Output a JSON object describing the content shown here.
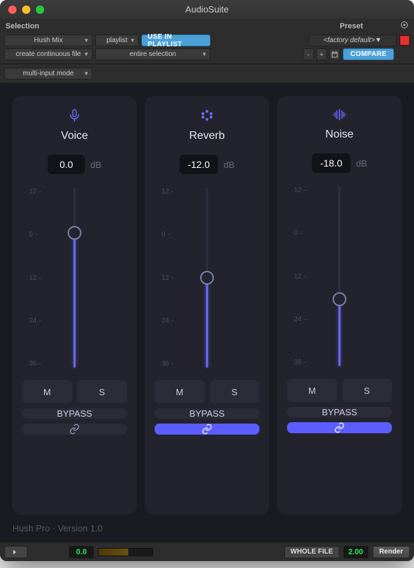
{
  "window": {
    "title": "AudioSuite"
  },
  "header": {
    "selection_label": "Selection",
    "preset_label": "Preset",
    "plugin_dd": "Hush Mix",
    "playlist_dd": "playlist",
    "use_in_playlist": "USE IN PLAYLIST",
    "factory_default": "<factory default>",
    "create_file_dd": "create continuous file",
    "selection_dd": "entire selection",
    "compare": "COMPARE",
    "minus": "-",
    "plus": "+",
    "input_mode_dd": "multi-input mode"
  },
  "channels": [
    {
      "key": "voice",
      "name": "Voice",
      "value": "0.0",
      "db_unit": "dB",
      "fill_pct": 75,
      "link_active": false,
      "icon": "mic"
    },
    {
      "key": "reverb",
      "name": "Reverb",
      "value": "-12.0",
      "db_unit": "dB",
      "fill_pct": 50,
      "link_active": true,
      "icon": "hex"
    },
    {
      "key": "noise",
      "name": "Noise",
      "value": "-18.0",
      "db_unit": "dB",
      "fill_pct": 37.5,
      "link_active": true,
      "icon": "wave"
    }
  ],
  "ticks": [
    "12",
    "0",
    "12",
    "24",
    "36"
  ],
  "buttons": {
    "mute": "M",
    "solo": "S",
    "bypass": "BYPASS"
  },
  "plugin_footer": "Hush Pro · Version 1.0",
  "bottom": {
    "level_value": "0.0",
    "whole_file": "WHOLE FILE",
    "handle_value": "2.00",
    "render": "Render"
  }
}
